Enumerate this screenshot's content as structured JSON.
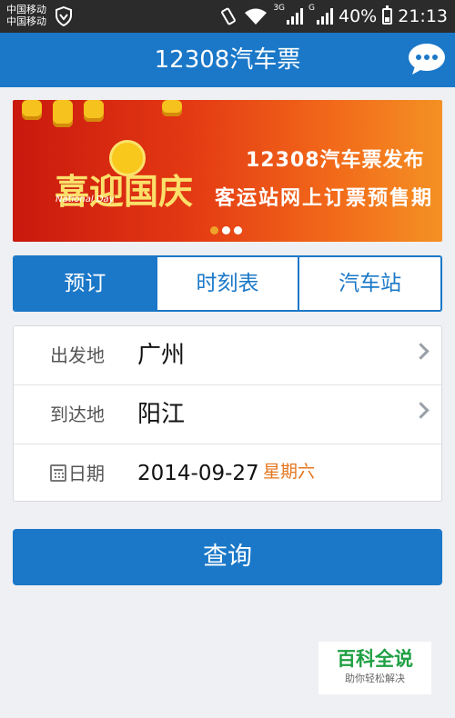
{
  "status_bar": {
    "carrier_1": "中国移动",
    "carrier_2": "中国移动",
    "net_1": "3G",
    "net_2": "G",
    "battery": "40%",
    "battery_level": 0.4,
    "time": "21:13"
  },
  "header": {
    "title": "12308汽车票",
    "chat_icon": "chat-bubble-icon"
  },
  "banner": {
    "headline": "喜迎国庆",
    "subtitle_en": "National Day",
    "line1": "12308汽车票发布",
    "line2": "客运站网上订票预售期",
    "dots_count": 3,
    "active_dot": 0
  },
  "tabs": [
    {
      "label": "预订",
      "active": true
    },
    {
      "label": "时刻表",
      "active": false
    },
    {
      "label": "汽车站",
      "active": false
    }
  ],
  "form": {
    "departure": {
      "label": "出发地",
      "value": "广州"
    },
    "arrival": {
      "label": "到达地",
      "value": "阳江"
    },
    "date": {
      "label": "日期",
      "value": "2014-09-27",
      "weekday": "星期六"
    }
  },
  "query_label": "查询",
  "watermark": {
    "title": "百科全说",
    "subtitle": "助你轻松解决"
  },
  "colors": {
    "primary": "#1b78c8",
    "accent_weekday": "#e4761e",
    "watermark_green": "#1fa043"
  }
}
